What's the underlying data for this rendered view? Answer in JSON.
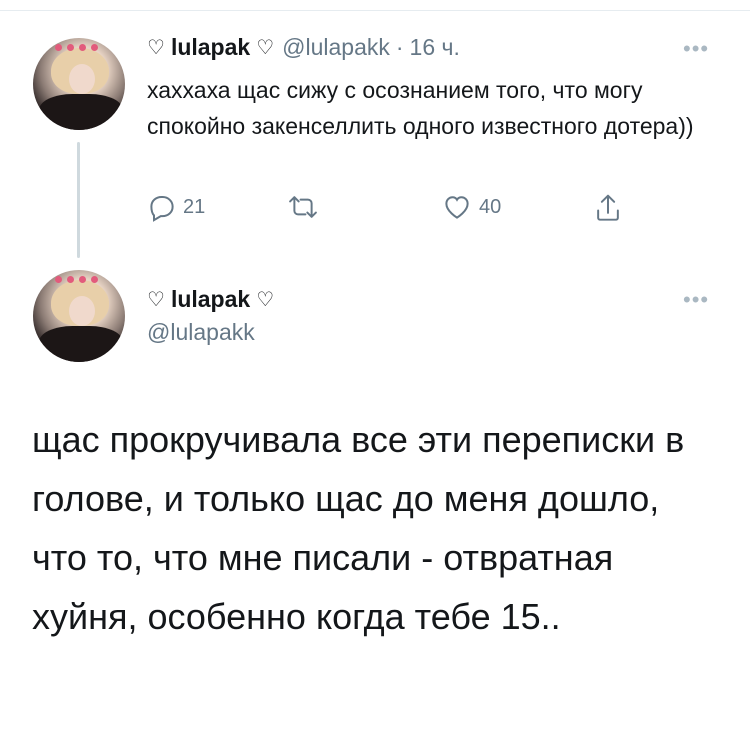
{
  "reply_tweet": {
    "heart_left": "♡",
    "display_name": "lulapak",
    "heart_right": "♡",
    "handle": "@lulapakk",
    "separator": "·",
    "time": "16 ч.",
    "text": "хаххаха щас сижу с осознанием того, что могу спокойно закенселлить одного известного дотера))",
    "replies": "21",
    "retweets": "",
    "likes": "40"
  },
  "main_tweet": {
    "heart_left": "♡",
    "display_name": "lulapak",
    "heart_right": "♡",
    "handle": "@lulapakk",
    "text": "щас прокручивала все эти переписки в голове, и только щас до меня дошло, что то, что мне писали - отвратная хуйня, особенно когда тебе 15.."
  },
  "icons": {
    "reply": "comment-icon",
    "retweet": "retweet-icon",
    "like": "heart-icon",
    "share": "share-icon",
    "more": "more-icon"
  },
  "colors": {
    "text": "#14171a",
    "secondary": "#657786",
    "icon": "#657786",
    "divider": "#e6ecf0",
    "thread_line": "#cfd9de",
    "more_dots": "#aab8c2"
  }
}
